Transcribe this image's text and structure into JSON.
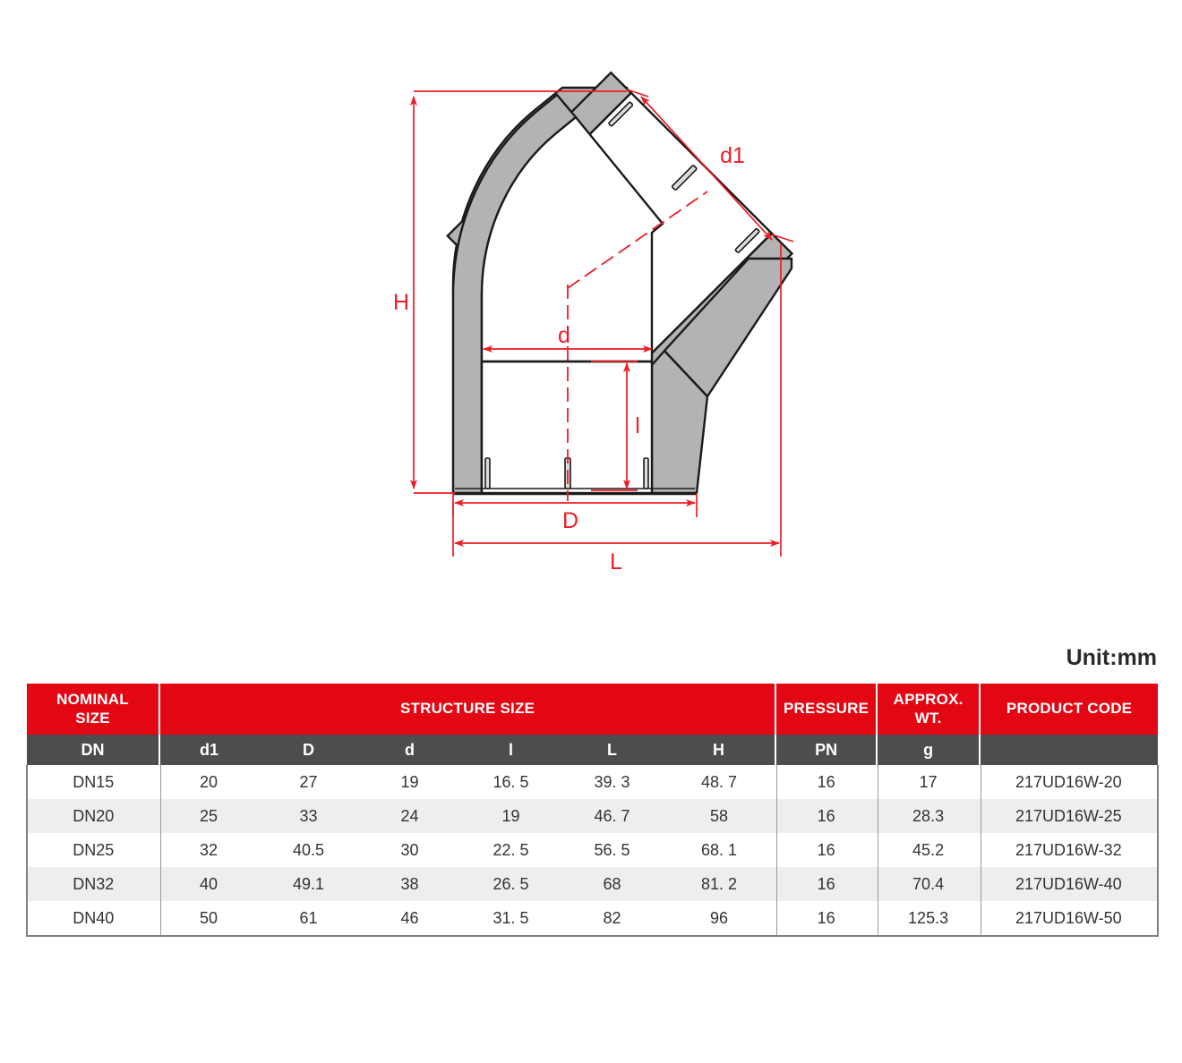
{
  "drawing": {
    "title": "45 degree elbow pipe fitting cross-section",
    "colors": {
      "dimension_red": "#ee1c25",
      "body_grey": "#b3b3b3",
      "outline": "#1a1a1a"
    },
    "dimension_labels": [
      {
        "name": "H",
        "text": "H",
        "meaning": "overall height"
      },
      {
        "name": "d1",
        "text": "d1",
        "meaning": "socket inner diameter of angled branch"
      },
      {
        "name": "d",
        "text": "d",
        "meaning": "socket inner diameter"
      },
      {
        "name": "l",
        "text": "l",
        "meaning": "socket depth"
      },
      {
        "name": "D",
        "text": "D",
        "meaning": "outer diameter"
      },
      {
        "name": "L",
        "text": "L",
        "meaning": "overall length"
      }
    ]
  },
  "unit_label": "Unit:mm",
  "table": {
    "group_headers": [
      {
        "label": "NOMINAL\nSIZE",
        "line1": "NOMINAL",
        "line2": "SIZE",
        "span": 1
      },
      {
        "label": "STRUCTURE SIZE",
        "line1": "STRUCTURE SIZE",
        "line2": "",
        "span": 6
      },
      {
        "label": "PRESSURE",
        "line1": "PRESSURE",
        "line2": "",
        "span": 1
      },
      {
        "label": "APPROX.\nWT.",
        "line1": "APPROX.",
        "line2": "WT.",
        "span": 1
      },
      {
        "label": "PRODUCT CODE",
        "line1": "PRODUCT CODE",
        "line2": "",
        "span": 1
      }
    ],
    "sub_headers": [
      "DN",
      "d1",
      "D",
      "d",
      "l",
      "L",
      "H",
      "PN",
      "g",
      ""
    ],
    "rows": [
      {
        "dn": "DN15",
        "d1": "20",
        "D": "27",
        "d": "19",
        "l": "16. 5",
        "L": "39. 3",
        "H": "48. 7",
        "pn": "16",
        "g": "17",
        "code": "217UD16W-20"
      },
      {
        "dn": "DN20",
        "d1": "25",
        "D": "33",
        "d": "24",
        "l": "19",
        "L": "46. 7",
        "H": "58",
        "pn": "16",
        "g": "28.3",
        "code": "217UD16W-25"
      },
      {
        "dn": "DN25",
        "d1": "32",
        "D": "40.5",
        "d": "30",
        "l": "22. 5",
        "L": "56. 5",
        "H": "68. 1",
        "pn": "16",
        "g": "45.2",
        "code": "217UD16W-32"
      },
      {
        "dn": "DN32",
        "d1": "40",
        "D": "49.1",
        "d": "38",
        "l": "26. 5",
        "L": "68",
        "H": "81. 2",
        "pn": "16",
        "g": "70.4",
        "code": "217UD16W-40"
      },
      {
        "dn": "DN40",
        "d1": "50",
        "D": "61",
        "d": "46",
        "l": "31. 5",
        "L": "82",
        "H": "96",
        "pn": "16",
        "g": "125.3",
        "code": "217UD16W-50"
      }
    ]
  }
}
